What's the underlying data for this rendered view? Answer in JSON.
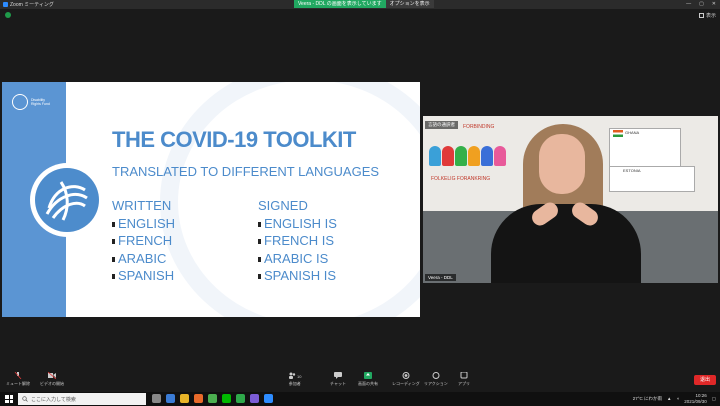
{
  "window": {
    "title": "Zoom ミーティング",
    "share_banner": "Veera - DDL の画面を表示しています",
    "view_options": "オプションを表示",
    "gallery_label": "表示"
  },
  "slide": {
    "title": "THE COVID-19 TOOLKIT",
    "subtitle": "TRANSLATED TO DIFFERENT LANGUAGES",
    "logo_text": "Disability Rights Fund",
    "written": {
      "heading": "WRITTEN",
      "items": [
        "ENGLISH",
        "FRENCH",
        "ARABIC",
        "SPANISH"
      ]
    },
    "signed": {
      "heading": "SIGNED",
      "items": [
        "ENGLISH IS",
        "FRENCH IS",
        "ARABIC IS",
        "SPANISH IS"
      ]
    }
  },
  "video": {
    "overlay_tag": "言語の通訳者",
    "participant_name": "Veera - DDL",
    "board_text_1": "FORBINDING",
    "board_text_2": "FOLKELIG FORANKRING",
    "card_title": "GHANA",
    "card2_title": "ESTONIA"
  },
  "toolbar": {
    "mute_label": "ミュート解除",
    "video_label": "ビデオの開始",
    "participants_label": "参加者",
    "participants_count": "10",
    "chat_label": "チャット",
    "share_label": "画面の共有",
    "record_label": "レコーディング",
    "reaction_label": "リアクション",
    "apps_label": "アプリ",
    "end_label": "退出"
  },
  "taskbar": {
    "search_placeholder": "ここに入力して検索",
    "weather": "27°C にわか雨",
    "time": "10:26",
    "date": "2021/09/30"
  },
  "colors": {
    "slide_blue": "#4c8bcb",
    "share_green": "#21a861",
    "end_red": "#e02828"
  }
}
